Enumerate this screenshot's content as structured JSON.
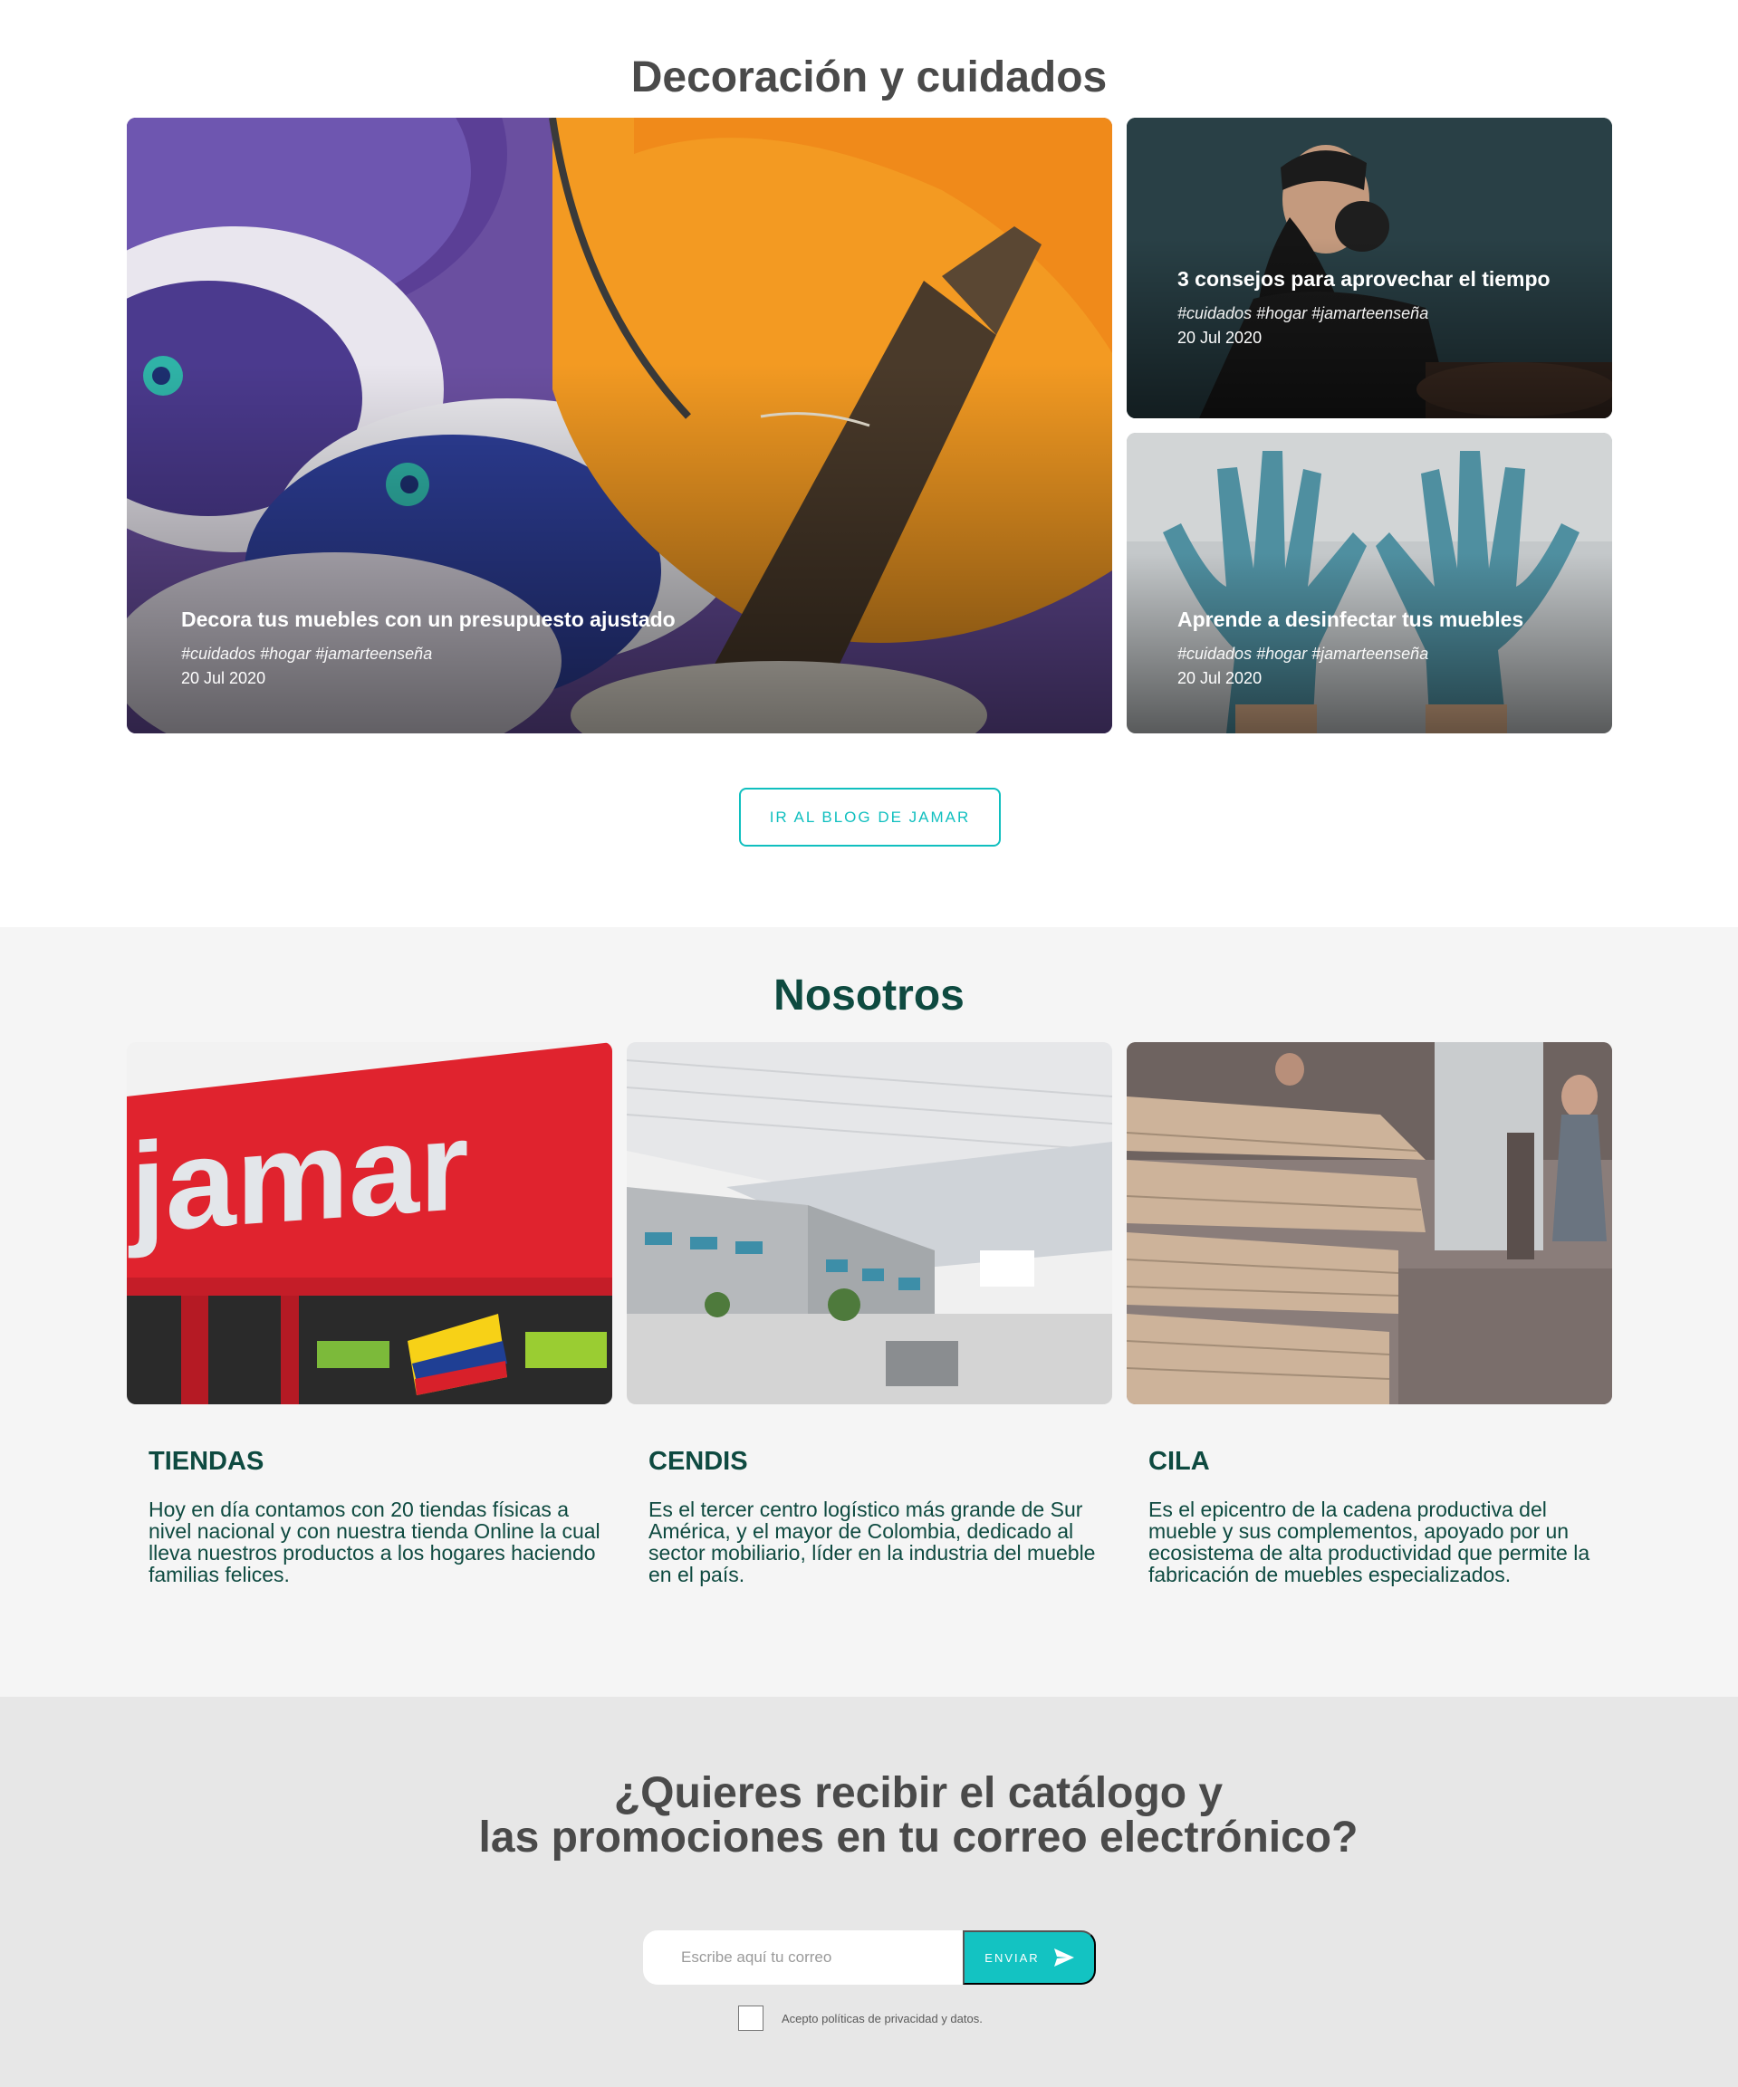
{
  "decoracion": {
    "title": "Decoración y cuidados",
    "cards": [
      {
        "title": "Decora tus muebles con un presupuesto ajustado",
        "tags": "#cuidados #hogar #jamarteenseña",
        "date": "20 Jul 2020"
      },
      {
        "title": "3 consejos para aprovechar el tiempo",
        "tags": "#cuidados #hogar #jamarteenseña",
        "date": "20 Jul 2020"
      },
      {
        "title": "Aprende a desinfectar tus muebles",
        "tags": "#cuidados #hogar #jamarteenseña",
        "date": "20 Jul 2020"
      }
    ],
    "blog_button": "IR AL BLOG DE JAMAR"
  },
  "nosotros": {
    "title": "Nosotros",
    "store_sign": "jamar",
    "columns": [
      {
        "title": "TIENDAS",
        "text": "Hoy en día contamos con 20 tiendas físicas a nivel nacional y con nuestra tienda Online la cual lleva nuestros productos a los hogares haciendo familias felices."
      },
      {
        "title": "CENDIS",
        "text": "Es el tercer centro logístico más grande de Sur América, y el mayor de Colombia, dedicado al sector mobiliario, líder en la industria del mueble en el país."
      },
      {
        "title": "CILA",
        "text": "Es el epicentro de la cadena productiva del mueble y sus complementos, apoyado por un ecosistema de alta productividad que permite la fabricación de muebles especializados."
      }
    ]
  },
  "newsletter": {
    "title_line1": "¿Quieres recibir el catálogo y",
    "title_line2": "las promociones en tu correo electrónico?",
    "email_placeholder": "Escribe aquí tu correo",
    "send_label": "ENVIAR",
    "send_icon": "paper-plane-icon",
    "checkbox_label": "Acepto políticas de privacidad y datos."
  },
  "colors": {
    "accent": "#13c3c2",
    "brand_dark": "#0e4a40",
    "heading_gray": "#4a4a4a"
  }
}
